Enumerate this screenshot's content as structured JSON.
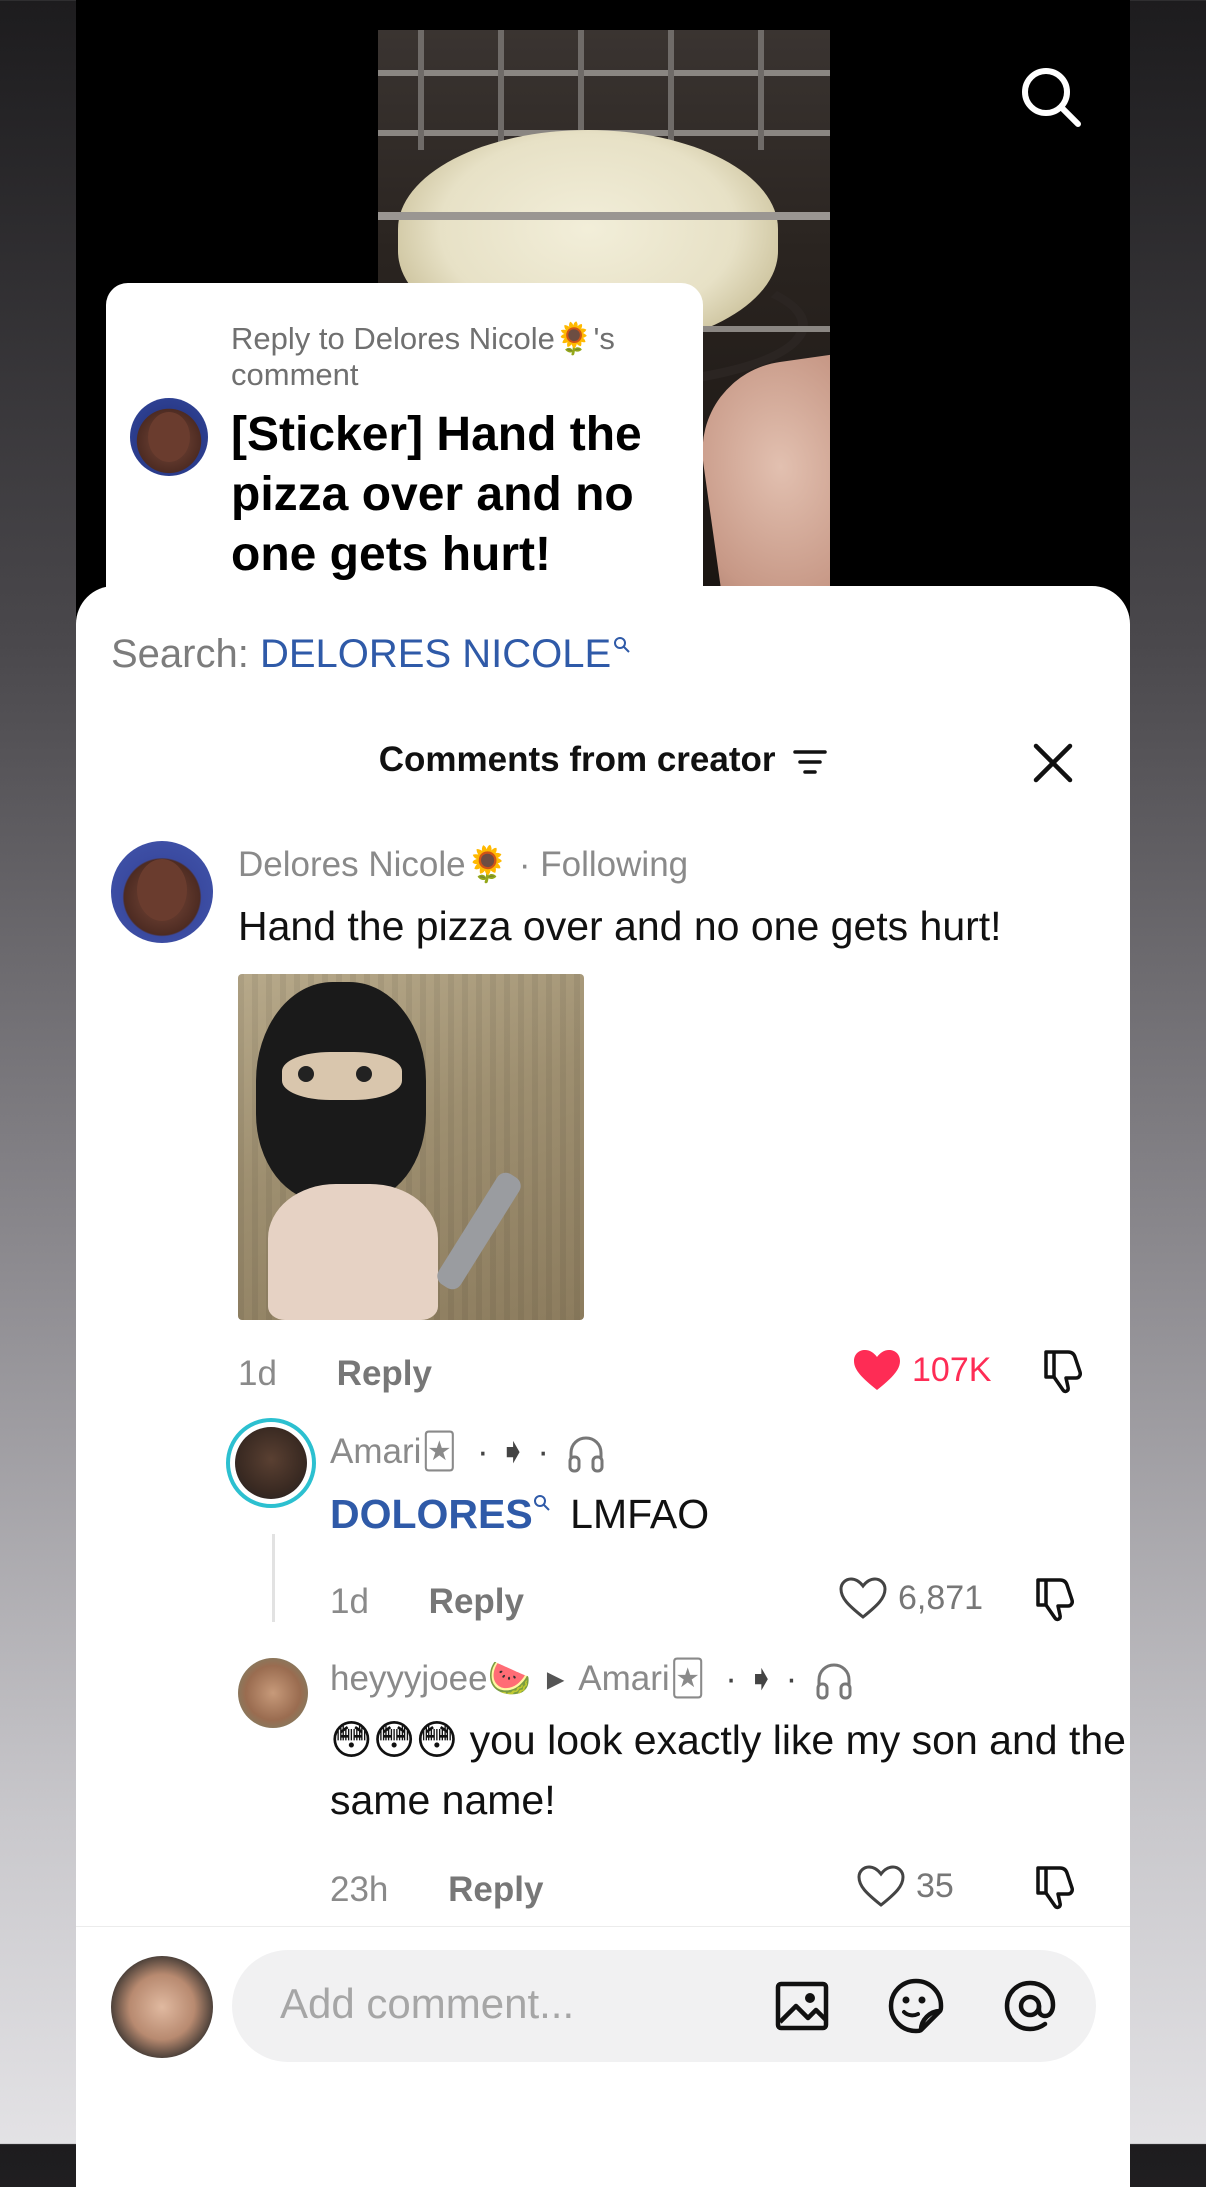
{
  "reply_card": {
    "reply_to": "Reply to Delores Nicole🌻's comment",
    "text": "[Sticker] Hand the pizza over and no one gets hurt!"
  },
  "search": {
    "prefix": "Search:",
    "term": "DELORES NICOLE"
  },
  "header": {
    "title": "Comments from creator"
  },
  "comments": [
    {
      "author": "Delores Nicole🌻",
      "status": "· Following",
      "text": "Hand the pizza over and no one gets hurt!",
      "time": "1d",
      "reply_label": "Reply",
      "likes": "107K",
      "liked": true
    },
    {
      "author": "Amari🃏",
      "badges": "· ➧ ·",
      "mention": "DOLORES",
      "text": "LMFAO",
      "time": "1d",
      "reply_label": "Reply",
      "likes": "6,871",
      "liked": false
    },
    {
      "author": "heyyyjoee🍉",
      "reply_to": "Amari🃏",
      "badges": "· ➧ ·",
      "text": "😳😳😳 you look exactly like my son and the same name!",
      "time": "23h",
      "reply_label": "Reply",
      "likes": "35",
      "liked": false
    }
  ],
  "composer": {
    "placeholder": "Add comment..."
  },
  "colors": {
    "accent_like": "#fe2c55",
    "mention_blue": "#2f5aa8"
  }
}
